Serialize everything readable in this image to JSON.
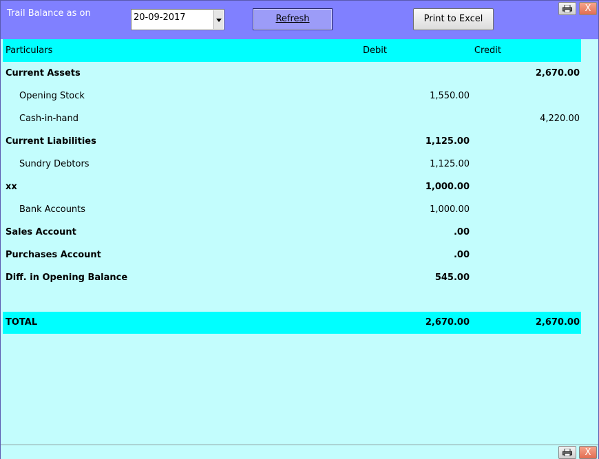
{
  "toolbar": {
    "label": "Trail Balance as on",
    "date_value": "20-09-2017",
    "refresh_label": "Refresh",
    "excel_label": "Print to Excel",
    "print_icon": "printer-icon",
    "close_label": "X"
  },
  "table": {
    "headers": {
      "particulars": "Particulars",
      "debit": "Debit",
      "credit": "Credit"
    },
    "rows": [
      {
        "particulars": "Current Assets",
        "debit": "",
        "credit": "2,670.00",
        "group": true
      },
      {
        "particulars": "Opening Stock",
        "debit": "1,550.00",
        "credit": "",
        "group": false
      },
      {
        "particulars": "Cash-in-hand",
        "debit": "",
        "credit": "4,220.00",
        "group": false
      },
      {
        "particulars": "Current Liabilities",
        "debit": "1,125.00",
        "credit": "",
        "group": true
      },
      {
        "particulars": "Sundry Debtors",
        "debit": "1,125.00",
        "credit": "",
        "group": false
      },
      {
        "particulars": "xx",
        "debit": "1,000.00",
        "credit": "",
        "group": true
      },
      {
        "particulars": "Bank Accounts",
        "debit": "1,000.00",
        "credit": "",
        "group": false
      },
      {
        "particulars": "Sales Account",
        "debit": ".00",
        "credit": "",
        "group": true
      },
      {
        "particulars": "Purchases Account",
        "debit": ".00",
        "credit": "",
        "group": true
      },
      {
        "particulars": "Diff. in Opening Balance",
        "debit": "545.00",
        "credit": "",
        "group": true
      },
      {
        "particulars": "",
        "debit": "",
        "credit": "",
        "group": false
      }
    ],
    "total": {
      "label": "TOTAL",
      "debit": "2,670.00",
      "credit": "2,670.00"
    }
  },
  "colors": {
    "toolbar_bg": "#8080ff",
    "header_bg": "#00ffff",
    "body_bg": "#c3fdfd"
  }
}
